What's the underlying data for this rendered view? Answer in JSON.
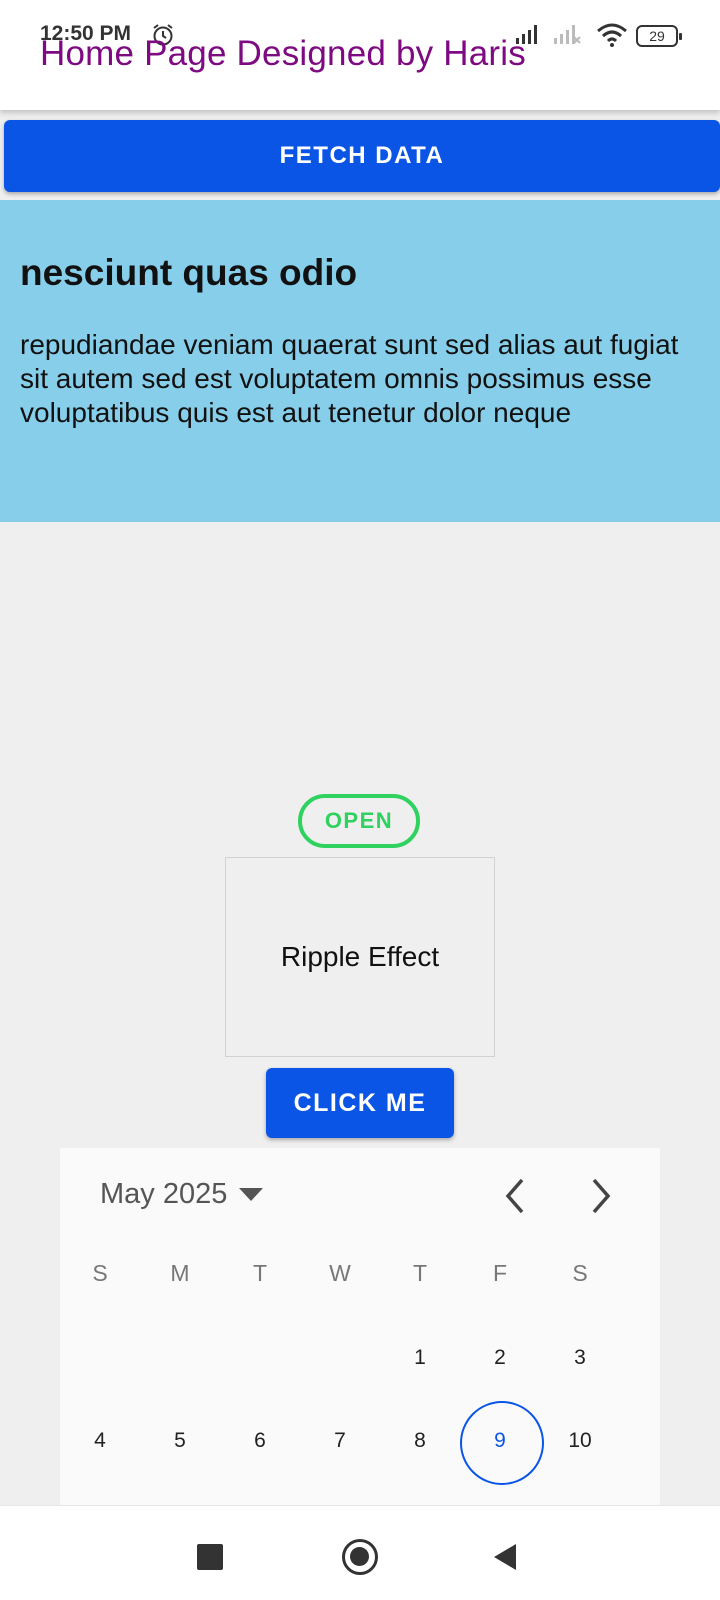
{
  "status_bar": {
    "time": "12:50 PM",
    "battery": "29",
    "icons": [
      "alarm-icon",
      "signal-icon",
      "signal-off-icon",
      "wifi-icon",
      "battery-icon"
    ]
  },
  "app_bar": {
    "title": "Home Page Designed by Haris",
    "title_color": "#7e0a82"
  },
  "fetch_button": {
    "label": "FETCH DATA",
    "color": "#0a55e6"
  },
  "post_card": {
    "title": "nesciunt quas odio",
    "body": "repudiandae veniam quaerat sunt sed alias aut fugiat sit autem sed est voluptatem omnis possimus esse voluptatibus quis est aut tenetur dolor neque",
    "background": "#87ceea"
  },
  "open_chip": {
    "label": "OPEN",
    "color": "#2fd15f"
  },
  "ripple_box": {
    "label": "Ripple Effect"
  },
  "click_button": {
    "label": "CLICK ME",
    "color": "#0a55e6"
  },
  "calendar": {
    "month_label": "May 2025",
    "weekdays": [
      "S",
      "M",
      "T",
      "W",
      "T",
      "F",
      "S"
    ],
    "weeks": [
      [
        "",
        "",
        "",
        "",
        "1",
        "2",
        "3"
      ],
      [
        "4",
        "5",
        "6",
        "7",
        "8",
        "9",
        "10"
      ]
    ],
    "selected_day": "9",
    "accent": "#0a55e6"
  },
  "nav_bar": {
    "icons": [
      "recents-square-icon",
      "home-circle-icon",
      "back-triangle-icon"
    ]
  }
}
